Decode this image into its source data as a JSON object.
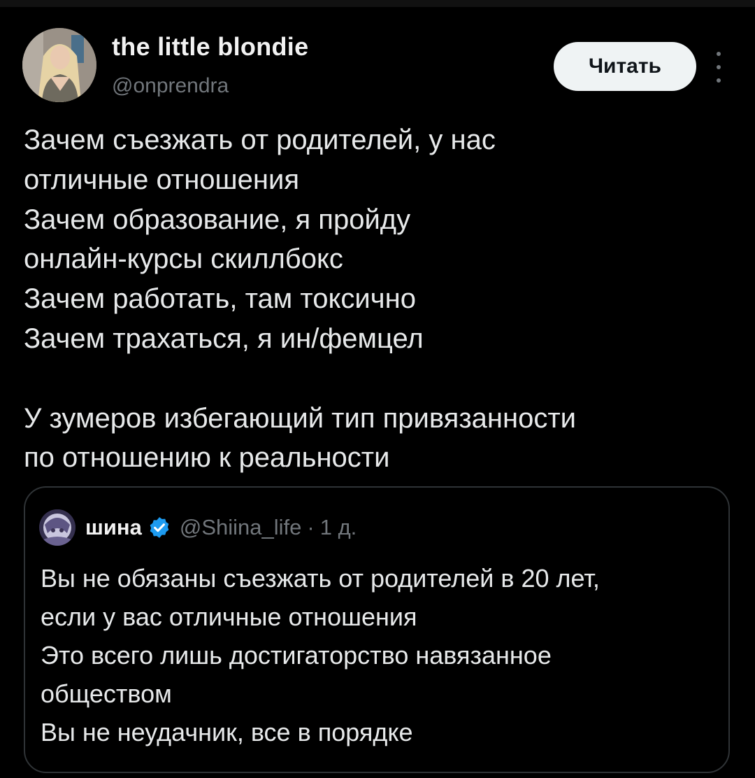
{
  "author": {
    "display_name": "the little blondie",
    "handle": "@onprendra",
    "avatar_icon": "profile-photo"
  },
  "actions": {
    "follow_label": "Читать",
    "more_icon": "more-vertical-icon"
  },
  "tweet": {
    "lines": [
      "Зачем съезжать от родителей, у нас",
      "отличные отношения",
      "Зачем образование, я пройду",
      "онлайн-курсы скиллбокс",
      "Зачем работать, там токсично",
      "Зачем трахаться, я ин/фемцел",
      "",
      "У зумеров избегающий тип привязанности",
      "по отношению к реальности"
    ]
  },
  "quote": {
    "author_name": "шина",
    "verified": true,
    "handle": "@Shiina_life",
    "separator": "·",
    "time": "1 д.",
    "lines": [
      "Вы не обязаны съезжать от родителей в 20 лет,",
      "если у вас отличные отношения",
      "Это всего лишь достигаторство навязанное",
      "обществом",
      "Вы не неудачник, все в порядке"
    ]
  },
  "colors": {
    "background": "#000000",
    "text_primary": "#e7e9ea",
    "text_secondary": "#71767b",
    "border": "#2f3336",
    "verified_blue": "#1d9bf0",
    "button_bg": "#eff3f4"
  }
}
